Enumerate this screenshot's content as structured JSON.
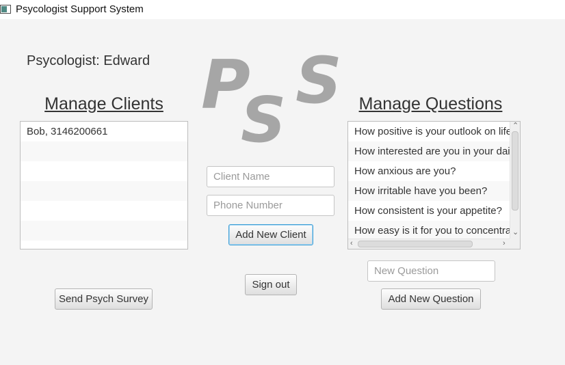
{
  "window": {
    "title": "Psycologist Support System",
    "icon": "app-window-icon"
  },
  "psychologist_label": "Psycologist: Edward",
  "logo": {
    "letters": [
      "P",
      "S",
      "S"
    ],
    "color": "#a6a6a6"
  },
  "clients": {
    "title": "Manage Clients",
    "items": [
      "Bob, 3146200661"
    ],
    "name_placeholder": "Client Name",
    "phone_placeholder": "Phone Number",
    "add_label": "Add New Client",
    "survey_label": "Send Psych Survey"
  },
  "signout_label": "Sign out",
  "questions": {
    "title": "Manage Questions",
    "items": [
      "How positive is your outlook on life?",
      "How interested are you in your daily activities?",
      "How anxious are you?",
      "How irritable have you been?",
      "How consistent is your appetite?",
      "How easy is it for you to concentrate?"
    ],
    "new_placeholder": "New Question",
    "add_label": "Add New Question"
  },
  "colors": {
    "background": "#f4f4f4",
    "focus_accent": "#3d9fd6"
  }
}
